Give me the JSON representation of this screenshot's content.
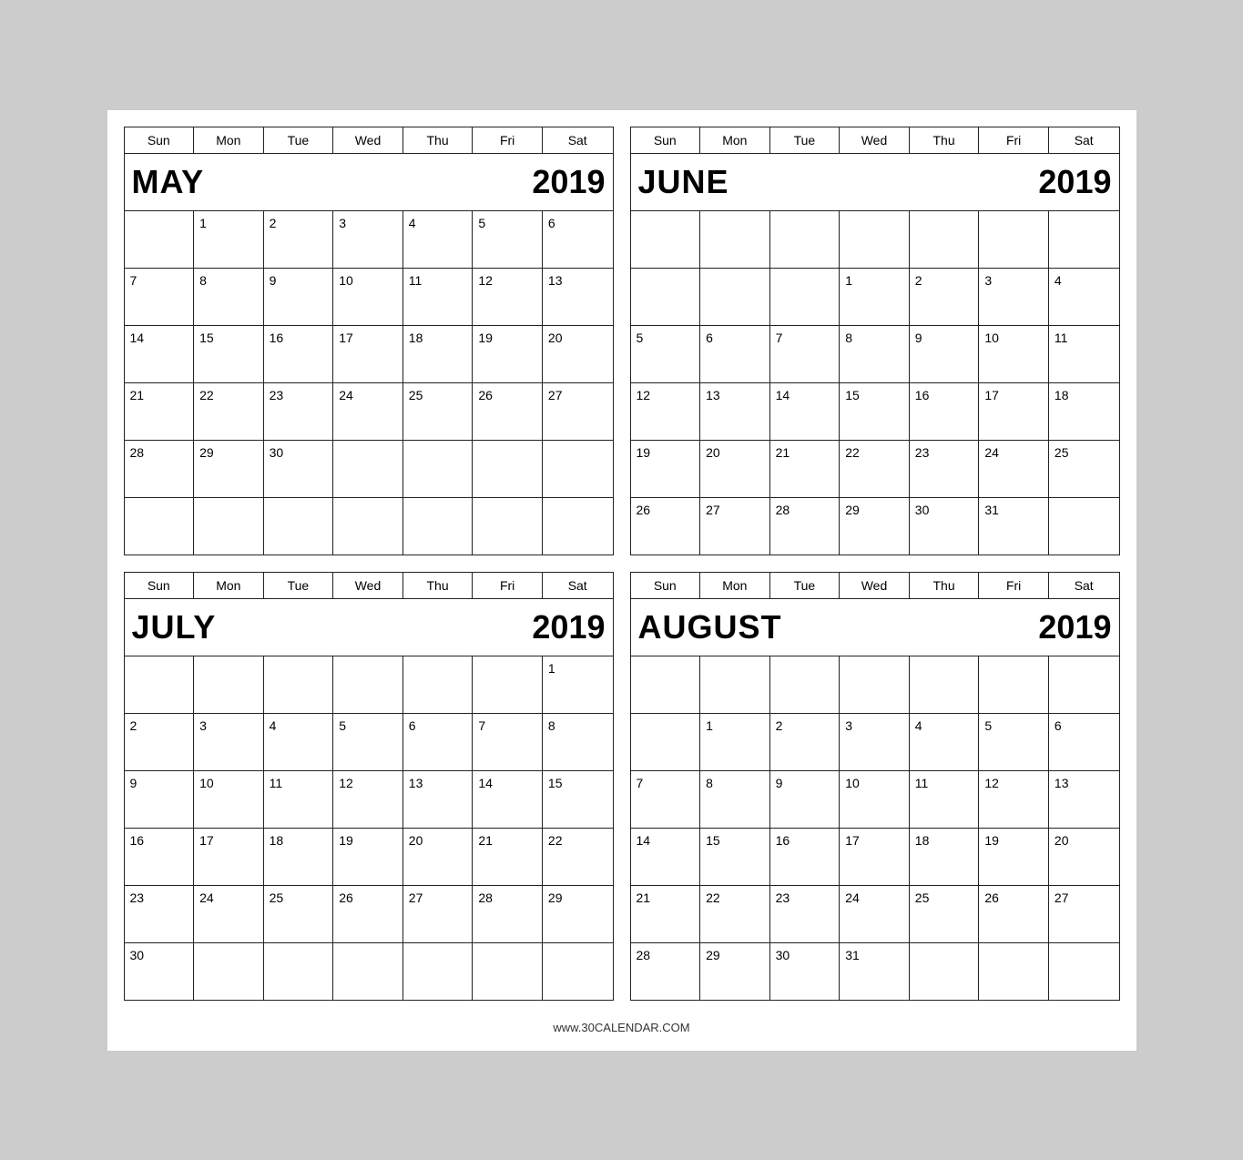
{
  "footer": "www.30CALENDAR.COM",
  "days": [
    "Sun",
    "Mon",
    "Tue",
    "Wed",
    "Thu",
    "Fri",
    "Sat"
  ],
  "calendars": [
    {
      "id": "may",
      "month": "MAY",
      "year": "2019",
      "weeks": [
        [
          "",
          "1",
          "2",
          "3",
          "4",
          "5",
          "6"
        ],
        [
          "7",
          "8",
          "9",
          "10",
          "11",
          "12",
          "13"
        ],
        [
          "14",
          "15",
          "16",
          "17",
          "18",
          "19",
          "20"
        ],
        [
          "21",
          "22",
          "23",
          "24",
          "25",
          "26",
          "27"
        ],
        [
          "28",
          "29",
          "30",
          "",
          "",
          "",
          ""
        ],
        [
          "",
          "",
          "",
          "",
          "",
          "",
          ""
        ]
      ]
    },
    {
      "id": "june",
      "month": "JUNE",
      "year": "2019",
      "weeks": [
        [
          "",
          "",
          "",
          "",
          "",
          "",
          ""
        ],
        [
          "",
          "",
          "",
          "1",
          "2",
          "3",
          "4"
        ],
        [
          "5",
          "6",
          "7",
          "8",
          "9",
          "10",
          "11"
        ],
        [
          "12",
          "13",
          "14",
          "15",
          "16",
          "17",
          "18"
        ],
        [
          "19",
          "20",
          "21",
          "22",
          "23",
          "24",
          "25"
        ],
        [
          "26",
          "27",
          "28",
          "29",
          "30",
          "31",
          ""
        ]
      ]
    },
    {
      "id": "july",
      "month": "JULY",
      "year": "2019",
      "weeks": [
        [
          "",
          "",
          "",
          "",
          "",
          "",
          "1"
        ],
        [
          "2",
          "3",
          "4",
          "5",
          "6",
          "7",
          "8"
        ],
        [
          "9",
          "10",
          "11",
          "12",
          "13",
          "14",
          "15"
        ],
        [
          "16",
          "17",
          "18",
          "19",
          "20",
          "21",
          "22"
        ],
        [
          "23",
          "24",
          "25",
          "26",
          "27",
          "28",
          "29"
        ],
        [
          "30",
          "",
          "",
          "",
          "",
          "",
          ""
        ]
      ]
    },
    {
      "id": "august",
      "month": "AUGUST",
      "year": "2019",
      "weeks": [
        [
          "",
          "",
          "",
          "",
          "",
          "",
          ""
        ],
        [
          "",
          "1",
          "2",
          "3",
          "4",
          "5",
          "6"
        ],
        [
          "7",
          "8",
          "9",
          "10",
          "11",
          "12",
          "13"
        ],
        [
          "14",
          "15",
          "16",
          "17",
          "18",
          "19",
          "20"
        ],
        [
          "21",
          "22",
          "23",
          "24",
          "25",
          "26",
          "27"
        ],
        [
          "28",
          "29",
          "30",
          "31",
          "",
          "",
          ""
        ]
      ]
    }
  ]
}
